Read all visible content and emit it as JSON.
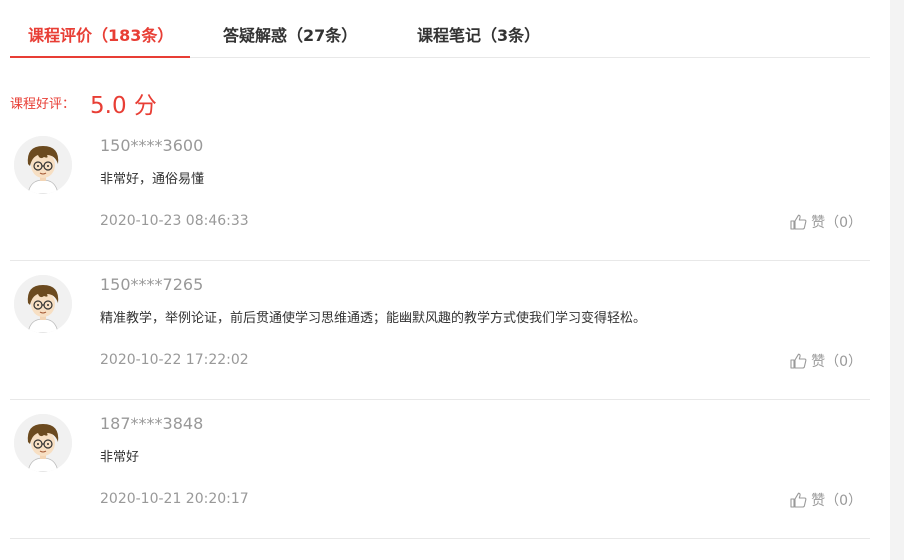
{
  "tabs": [
    {
      "label": "课程评价（183条）"
    },
    {
      "label": "答疑解惑（27条）"
    },
    {
      "label": "课程笔记（3条）"
    }
  ],
  "rating": {
    "label": "课程好评：",
    "value": "5.0 分"
  },
  "reviews": [
    {
      "user": "150****3600",
      "content": "非常好，通俗易懂",
      "time": "2020-10-23 08:46:33",
      "like": "赞（0）"
    },
    {
      "user": "150****7265",
      "content": "精准教学，举例论证，前后贯通使学习思维通透；能幽默风趣的教学方式使我们学习变得轻松。",
      "time": "2020-10-22 17:22:02",
      "like": "赞（0）"
    },
    {
      "user": "187****3848",
      "content": "非常好",
      "time": "2020-10-21 20:20:17",
      "like": "赞（0）"
    }
  ],
  "colors": {
    "accent": "#e83e35",
    "muted": "#999999",
    "divider": "#e8e8e8"
  },
  "icons": {
    "avatar": "cartoon-avatar-icon",
    "like": "thumbs-up-icon"
  }
}
